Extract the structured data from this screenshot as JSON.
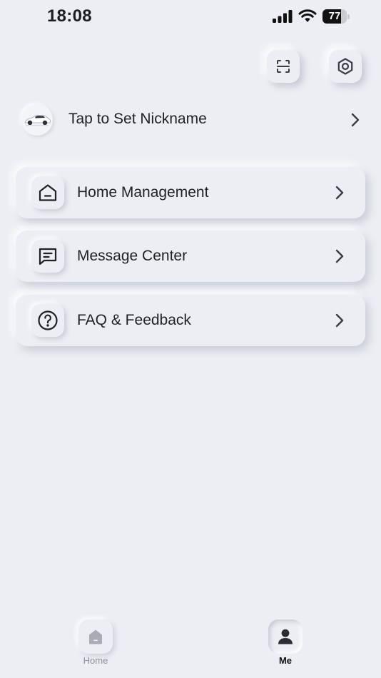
{
  "status_bar": {
    "time": "18:08",
    "battery_level": "77",
    "battery_fraction": 0.77
  },
  "header_actions": {
    "scan_icon": "scan-icon",
    "settings_icon": "settings-hex-icon"
  },
  "profile": {
    "nickname_label": "Tap to Set Nickname",
    "avatar_icon": "car-avatar"
  },
  "menu": {
    "items": [
      {
        "label": "Home Management",
        "icon": "home-icon"
      },
      {
        "label": "Message Center",
        "icon": "message-icon"
      },
      {
        "label": "FAQ & Feedback",
        "icon": "question-icon"
      }
    ]
  },
  "tab_bar": {
    "tabs": [
      {
        "label": "Home",
        "icon": "home-tab-icon",
        "active": false
      },
      {
        "label": "Me",
        "icon": "person-icon",
        "active": true
      }
    ]
  },
  "colors": {
    "background": "#eceef3",
    "text": "#1f2126",
    "inactive_tab": "#8d9099",
    "active_tab": "#111111"
  }
}
